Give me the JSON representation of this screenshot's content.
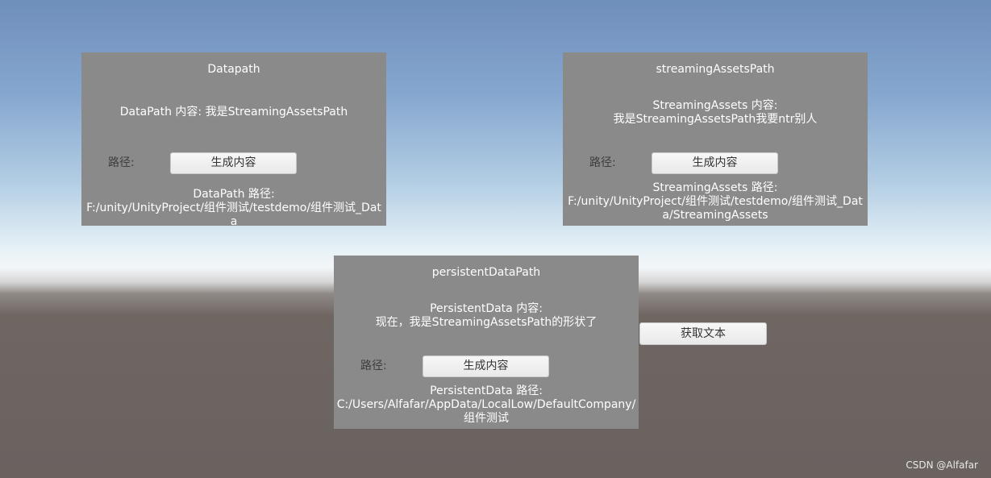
{
  "panels": {
    "datapath": {
      "title": "Datapath",
      "content_lines": [
        "DataPath 内容: 我是StreamingAssetsPath"
      ],
      "path_label": "路径:",
      "button_label": "生成内容",
      "path_text": "DataPath 路径:\nF:/unity/UnityProject/组件测试/testdemo/组件测试_Data"
    },
    "streaming": {
      "title": "streamingAssetsPath",
      "content_lines": [
        "StreamingAssets 内容:",
        "我是StreamingAssetsPath我要ntr别人"
      ],
      "path_label": "路径:",
      "button_label": "生成内容",
      "path_text": "StreamingAssets 路径:\nF:/unity/UnityProject/组件测试/testdemo/组件测试_Data/StreamingAssets"
    },
    "persistent": {
      "title": "persistentDataPath",
      "content_lines": [
        "PersistentData 内容:",
        "现在，我是StreamingAssetsPath的形状了"
      ],
      "path_label": "路径:",
      "button_label": "生成内容",
      "path_text": "PersistentData 路径:\nC:/Users/Alfafar/AppData/LocalLow/DefaultCompany/组件测试"
    }
  },
  "fetch_button_label": "获取文本",
  "watermark": "CSDN @Alfafar"
}
